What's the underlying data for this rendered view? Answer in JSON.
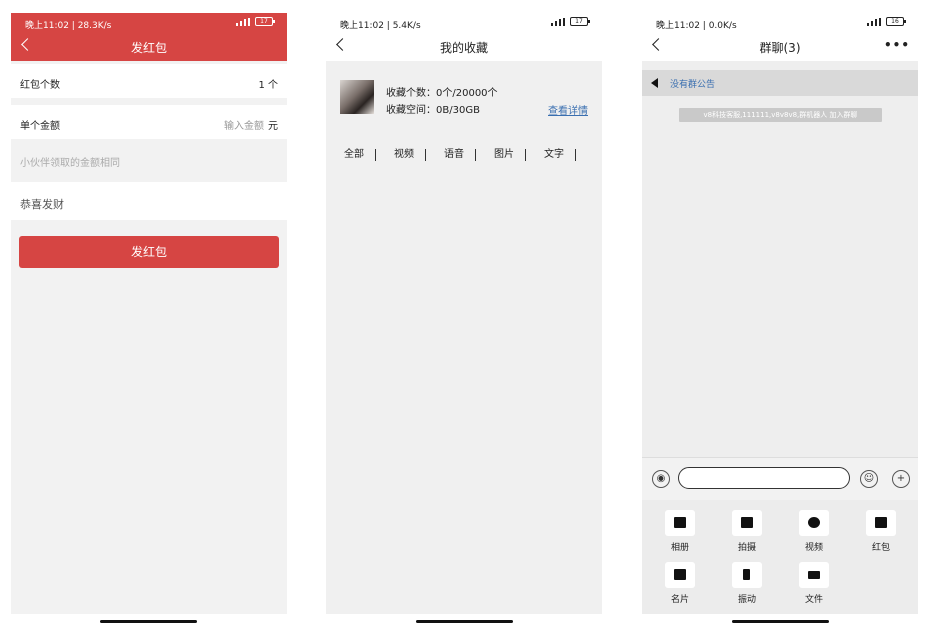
{
  "panel1": {
    "status": {
      "left": "晚上11:02 | 28.3K/s",
      "battery": "17"
    },
    "title": "发红包",
    "count_label": "红包个数",
    "count_value": "1 个",
    "amount_label": "单个金额",
    "amount_placeholder": "输入金额",
    "amount_unit": "元",
    "note": "小伙伴领取的金额相同",
    "greeting": "恭喜发财",
    "send_button": "发红包"
  },
  "panel2": {
    "status": {
      "left": "晚上11:02 | 5.4K/s",
      "battery": "17"
    },
    "title": "我的收藏",
    "count_text": "收藏个数：0个/20000个",
    "space_text": "收藏空间：0B/30GB",
    "detail_link": "查看详情",
    "tabs": [
      "全部",
      "视频",
      "语音",
      "图片",
      "文字"
    ]
  },
  "panel3": {
    "status": {
      "left": "晚上11:02 | 0.0K/s",
      "battery": "16"
    },
    "title": "群聊(3)",
    "more": "•••",
    "notice": "没有群公告",
    "join_msg": "v8科技客服,111111,v8v8v8,群机器人 加入群聊",
    "tools": [
      {
        "label": "相册",
        "icon": "album-icon"
      },
      {
        "label": "拍摄",
        "icon": "camera-icon"
      },
      {
        "label": "视频",
        "icon": "video-icon"
      },
      {
        "label": "红包",
        "icon": "red-packet-icon"
      },
      {
        "label": "名片",
        "icon": "card-icon"
      },
      {
        "label": "振动",
        "icon": "vibrate-icon"
      },
      {
        "label": "文件",
        "icon": "folder-icon"
      }
    ]
  }
}
